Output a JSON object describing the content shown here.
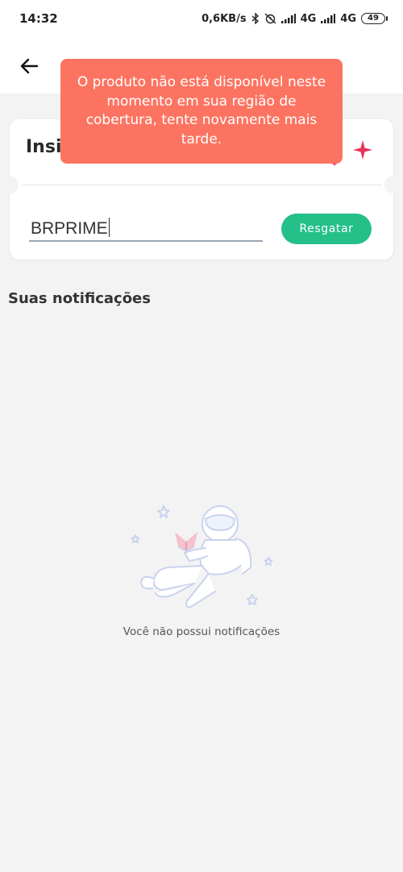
{
  "status_bar": {
    "time": "14:32",
    "network_speed": "0,6KB/s",
    "network_1": "4G",
    "network_2": "4G",
    "battery": "49"
  },
  "header": {
    "back_icon": "arrow-left-icon"
  },
  "coupon_card": {
    "title": "Insir",
    "code_value": "BRPRIME",
    "redeem_label": "Resgatar",
    "accent_color": "#25c08a",
    "sparkle_color": "#e8345a"
  },
  "toast": {
    "message": "O produto não está disponível neste momento em sua região de cobertura, tente novamente mais tarde.",
    "color": "#fc7461"
  },
  "notifications": {
    "section_title": "Suas notificações",
    "empty_message": "Você não possui notificações",
    "empty_illustration": "astronaut-reading-icon"
  }
}
